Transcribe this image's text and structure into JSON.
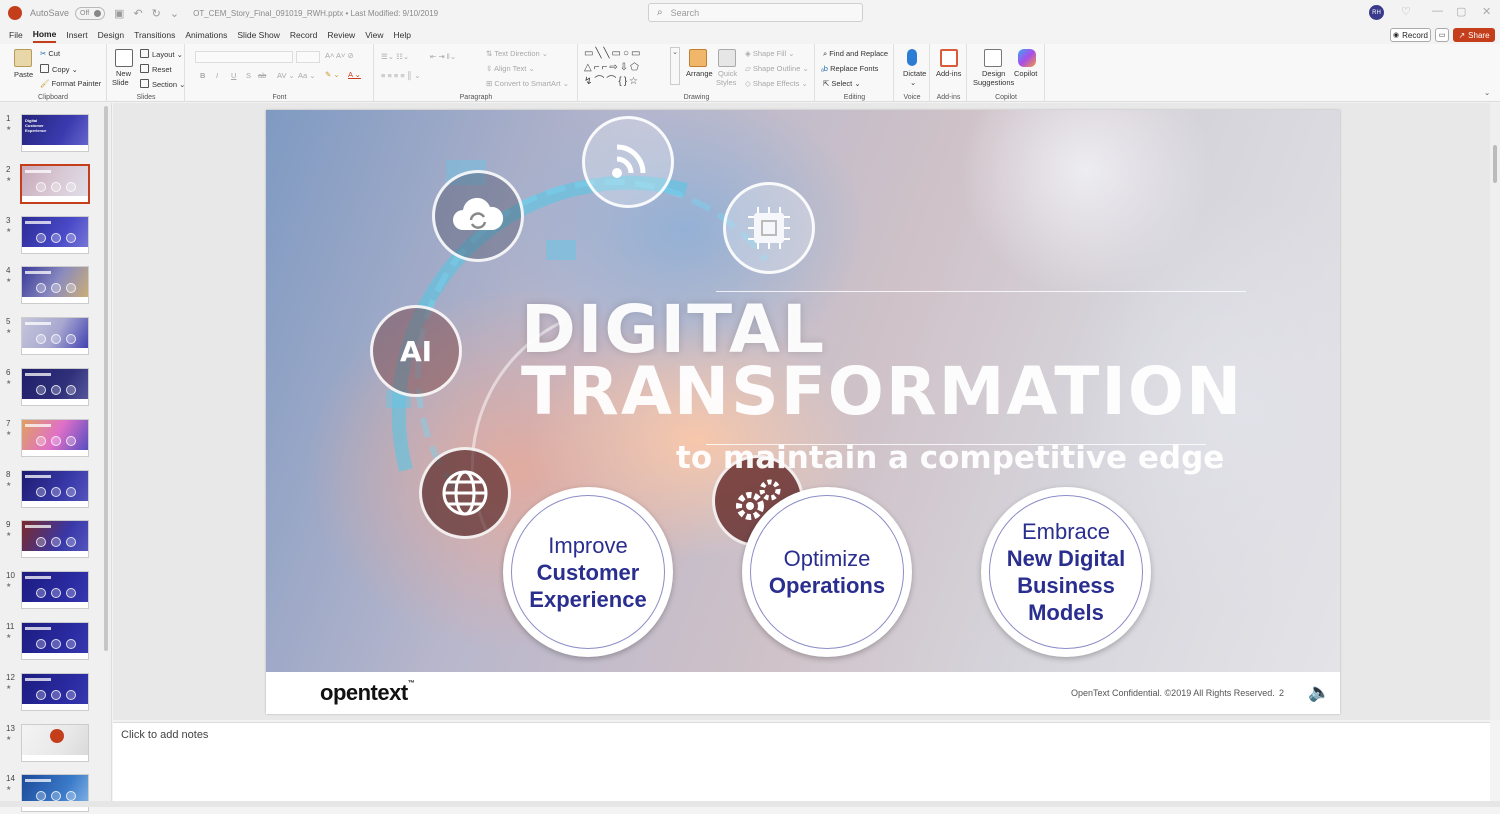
{
  "titlebar": {
    "autosave_label": "AutoSave",
    "autosave_state": "Off",
    "document_title": "OT_CEM_Story_Final_091019_RWH.pptx",
    "last_modified": "Last Modified: 9/10/2019",
    "search_placeholder": "Search",
    "user_initials": "RH"
  },
  "menu": {
    "items": [
      "File",
      "Home",
      "Insert",
      "Design",
      "Transitions",
      "Animations",
      "Slide Show",
      "Record",
      "Review",
      "View",
      "Help"
    ],
    "active": "Home",
    "record_label": "Record",
    "share_label": "Share"
  },
  "ribbon": {
    "clipboard": {
      "label": "Clipboard",
      "paste": "Paste",
      "cut": "Cut",
      "copy": "Copy",
      "format_painter": "Format Painter"
    },
    "slides": {
      "label": "Slides",
      "new_slide_line1": "New",
      "new_slide_line2": "Slide",
      "layout": "Layout",
      "reset": "Reset",
      "section": "Section"
    },
    "font": {
      "label": "Font"
    },
    "paragraph": {
      "label": "Paragraph",
      "text_direction": "Text Direction",
      "align_text": "Align Text",
      "convert_smartart": "Convert to SmartArt"
    },
    "drawing": {
      "label": "Drawing",
      "arrange": "Arrange",
      "quick_styles_line1": "Quick",
      "quick_styles_line2": "Styles",
      "shape_fill": "Shape Fill",
      "shape_outline": "Shape Outline",
      "shape_effects": "Shape Effects"
    },
    "editing": {
      "label": "Editing",
      "find_replace": "Find and Replace",
      "replace_fonts": "Replace Fonts",
      "select": "Select"
    },
    "voice": {
      "label": "Voice",
      "dictate": "Dictate"
    },
    "addins": {
      "label": "Add-ins",
      "addins": "Add-ins"
    },
    "copilot": {
      "label": "Copilot",
      "design_line1": "Design",
      "design_line2": "Suggestions",
      "copilot": "Copilot"
    }
  },
  "thumbnails": {
    "numbers": [
      "1",
      "2",
      "3",
      "4",
      "5",
      "6",
      "7",
      "8",
      "9",
      "10",
      "11",
      "12",
      "13",
      "14"
    ],
    "selected": "2",
    "slide1_title": "Digital Customer Experience"
  },
  "slide": {
    "title_line1": "DIGITAL",
    "title_line2": "TRANSFORMATION",
    "subtitle": "to maintain a competitive edge",
    "circles": [
      {
        "line1": "Improve",
        "line2": "Customer",
        "line3": "Experience"
      },
      {
        "line1": "Optimize",
        "line2": "Operations"
      },
      {
        "line1": "Embrace",
        "line2": "New Digital",
        "line3": "Business",
        "line4": "Models"
      }
    ],
    "icon_ai_label": "AI",
    "logo": "opentext",
    "logo_tm": "™",
    "confidential": "OpenText Confidential. ©2019 All Rights Reserved.",
    "page_number": "2"
  },
  "notes": {
    "placeholder": "Click to add notes"
  },
  "colors": {
    "accent": "#c43e1c",
    "circle_text": "#2a2f8f"
  }
}
